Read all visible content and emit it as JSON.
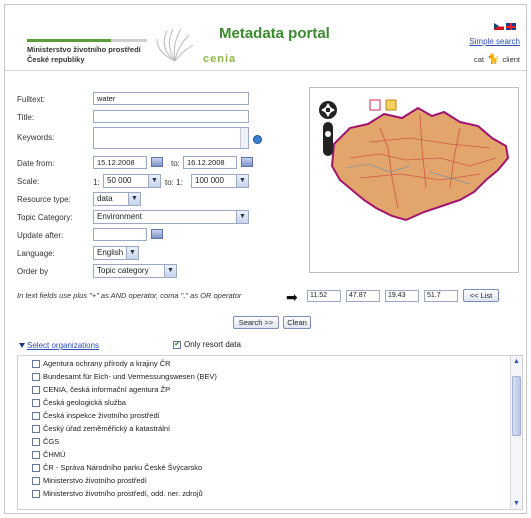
{
  "header": {
    "ministry_line1": "Ministerstvo životního prostředí",
    "ministry_line2": "České republiky",
    "logo_text": "cenia",
    "title": "Metadata portal",
    "simple_search": "Simple search",
    "client_prefix": "cat",
    "client_suffix": "client"
  },
  "form": {
    "fulltext_label": "Fulltext:",
    "fulltext_value": "water",
    "title_label": "Title:",
    "title_value": "",
    "keywords_label": "Keywords:",
    "date_from_label": "Date from:",
    "date_from_value": "15.12.2008",
    "date_to_label": "to:",
    "date_to_value": "16.12.2008",
    "scale_label": "Scale:",
    "scale_from_prefix": "1:",
    "scale_from_value": "50 000",
    "scale_to_prefix": "to: 1:",
    "scale_to_value": "100 000",
    "resource_type_label": "Resource type:",
    "resource_type_value": "data",
    "topic_category_label": "Topic Category:",
    "topic_category_value": "Environment",
    "update_after_label": "Update after:",
    "update_after_value": "",
    "language_label": "Language:",
    "language_value": "English",
    "order_by_label": "Order by",
    "order_by_value": "Topic category"
  },
  "hint": "In text fields use plus \"+\" as AND operator, coma \",\" as OR operator",
  "coords": {
    "values": [
      "11.52",
      "47.87",
      "19.43",
      "51.7"
    ],
    "list_button": "<< List"
  },
  "buttons": {
    "search": "Search >>",
    "clean": "Clean"
  },
  "orgs": {
    "select_label": "Select organizations",
    "only_resort": "Only resort data",
    "items": [
      "Agentura ochrany přírody a krajiny ČR",
      "Bundesamt für Eich- und Vermessungswesen (BEV)",
      "CENIA, česká informační agentura ŽP",
      "Česká geologická služba",
      "Česká inspekce životního prostředí",
      "Český úřad zeměměřický a katastrální",
      "ČGS",
      "ČHMÚ",
      "ČR - Správa Národního parku České Švýcarsko",
      "Ministerstvo životního prostředí",
      "Ministerstvo životního prostředí, odd. ner. zdrojů"
    ]
  },
  "colors": {
    "title_green": "#3a8a2e",
    "link_blue": "#2b4fb5",
    "map_land": "#d6945a",
    "map_border": "#a0146e"
  }
}
